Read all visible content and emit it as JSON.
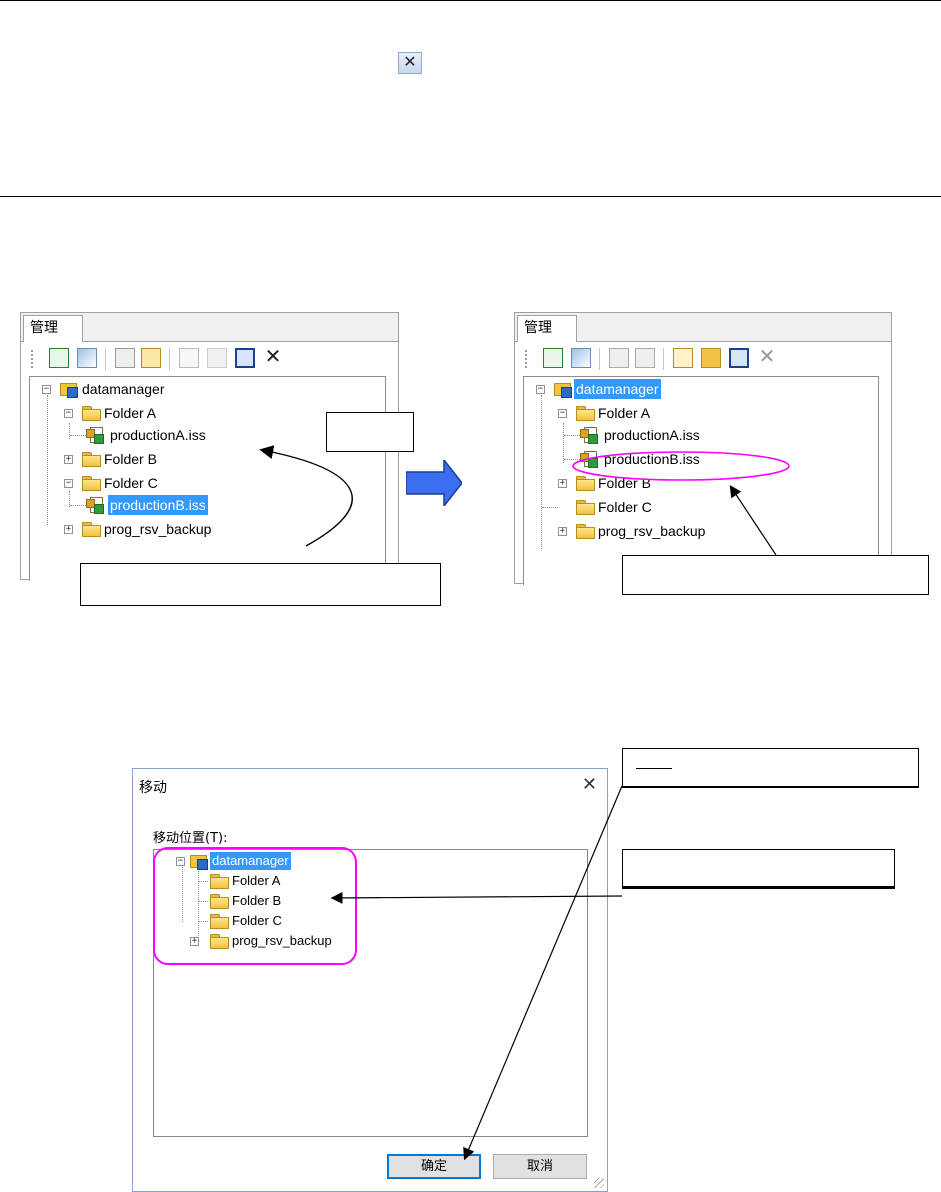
{
  "top_icon": "close-x-icon",
  "panel": {
    "tab_label": "管理",
    "toolbar_icons": [
      "refresh-icon",
      "properties-icon",
      "copy-icon",
      "paste-icon",
      "new-file-icon",
      "new-folder-icon",
      "rename-icon",
      "delete-icon"
    ]
  },
  "before_tree": {
    "root": "datamanager",
    "folder_a": "Folder A",
    "file_a": "productionA.iss",
    "folder_b": "Folder B",
    "folder_c": "Folder C",
    "file_b": "productionB.iss",
    "backup": "prog_rsv_backup"
  },
  "after_tree": {
    "root": "datamanager",
    "folder_a": "Folder A",
    "file_a": "productionA.iss",
    "file_b": "productionB.iss",
    "folder_b": "Folder B",
    "folder_c": "Folder C",
    "backup": "prog_rsv_backup"
  },
  "colors": {
    "selection": "#3399ff",
    "highlight_ring": "#ff00ff",
    "big_arrow": "#3b6ff0"
  },
  "dialog": {
    "title": "移动",
    "close_glyph": "✕",
    "location_label": "移动位置(T):",
    "tree": {
      "root": "datamanager",
      "folder_a": "Folder A",
      "folder_b": "Folder B",
      "folder_c": "Folder C",
      "backup": "prog_rsv_backup"
    },
    "ok_label": "确定",
    "cancel_label": "取消"
  }
}
